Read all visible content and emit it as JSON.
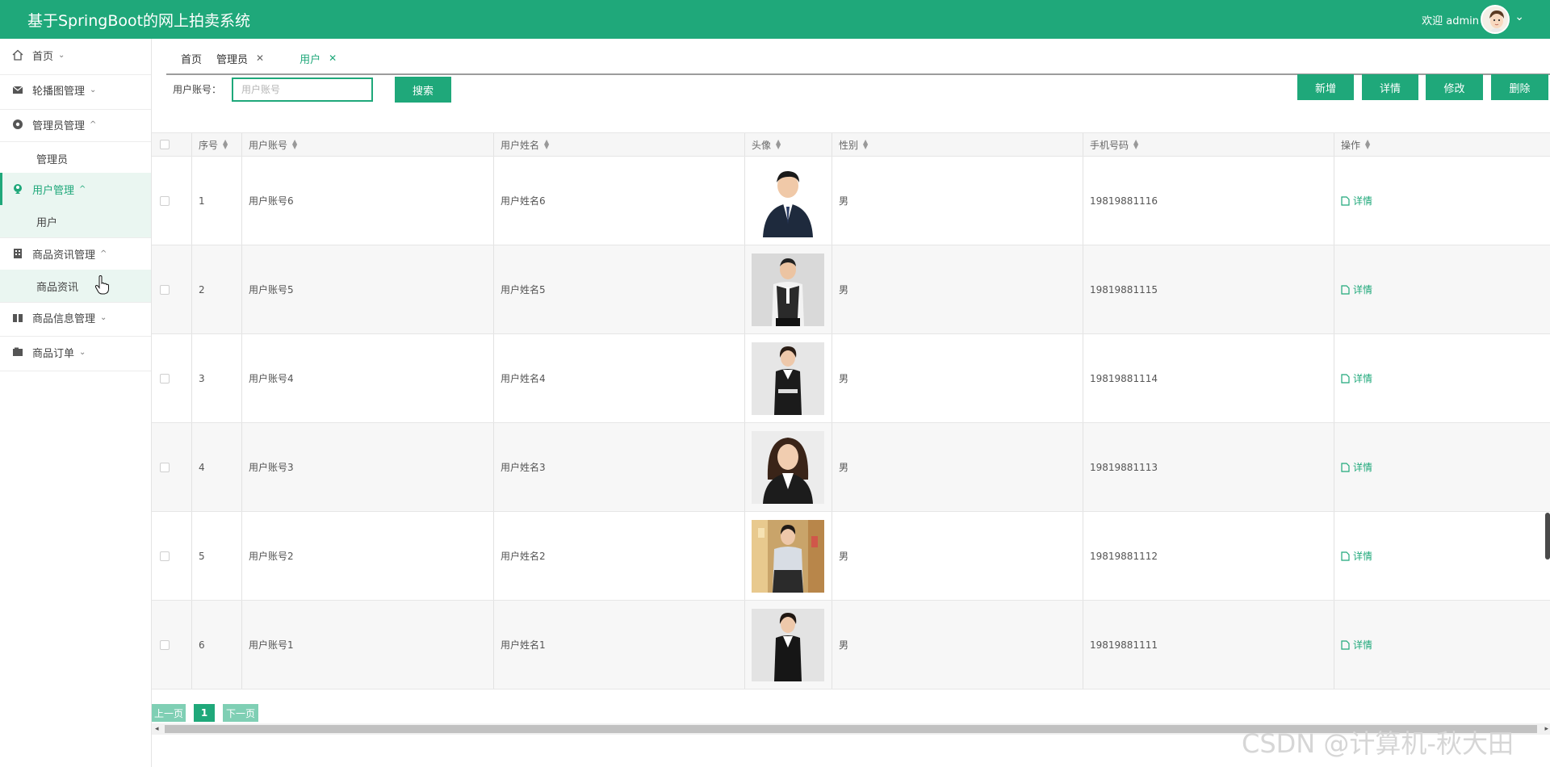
{
  "app": {
    "title": "基于SpringBoot的网上拍卖系统"
  },
  "header": {
    "welcome": "欢迎 admin",
    "avatar_icon": "avatar-icon",
    "caret": "⌄"
  },
  "sidebar": {
    "items": [
      {
        "label": "首页",
        "icon": "home-icon",
        "chevron": "⌄"
      },
      {
        "label": "轮播图管理",
        "icon": "mail-icon",
        "chevron": "⌄"
      },
      {
        "label": "管理员管理",
        "icon": "settings-icon",
        "chevron": "^",
        "children": [
          "管理员"
        ]
      },
      {
        "label": "用户管理",
        "icon": "user-badge-icon",
        "chevron": "^",
        "children": [
          "用户"
        ]
      },
      {
        "label": "商品资讯管理",
        "icon": "building-icon",
        "chevron": "^",
        "children": [
          "商品资讯"
        ]
      },
      {
        "label": "商品信息管理",
        "icon": "gift-icon",
        "chevron": "⌄"
      },
      {
        "label": "商品订单",
        "icon": "folder-icon",
        "chevron": "⌄"
      }
    ],
    "active": "用户管理"
  },
  "tabs": [
    {
      "label": "首页",
      "closable": false
    },
    {
      "label": "管理员",
      "closable": true
    },
    {
      "label": "用户",
      "closable": true,
      "active": true
    }
  ],
  "search": {
    "label": "用户账号：",
    "placeholder": "用户账号",
    "value": "",
    "button": "搜索"
  },
  "toolbar": {
    "add": "新增",
    "detail": "详情",
    "edit": "修改",
    "delete": "删除"
  },
  "table": {
    "columns": [
      "序号",
      "用户账号",
      "用户姓名",
      "头像",
      "性别",
      "手机号码",
      "操作"
    ],
    "rows": [
      {
        "index": "1",
        "account": "用户账号6",
        "name": "用户姓名6",
        "gender": "男",
        "phone": "19819881116",
        "action": "详情"
      },
      {
        "index": "2",
        "account": "用户账号5",
        "name": "用户姓名5",
        "gender": "男",
        "phone": "19819881115",
        "action": "详情"
      },
      {
        "index": "3",
        "account": "用户账号4",
        "name": "用户姓名4",
        "gender": "男",
        "phone": "19819881114",
        "action": "详情"
      },
      {
        "index": "4",
        "account": "用户账号3",
        "name": "用户姓名3",
        "gender": "男",
        "phone": "19819881113",
        "action": "详情"
      },
      {
        "index": "5",
        "account": "用户账号2",
        "name": "用户姓名2",
        "gender": "男",
        "phone": "19819881112",
        "action": "详情"
      },
      {
        "index": "6",
        "account": "用户账号1",
        "name": "用户姓名1",
        "gender": "男",
        "phone": "19819881111",
        "action": "详情"
      }
    ]
  },
  "pager": {
    "prev": "上一页",
    "current": "1",
    "next": "下一页"
  },
  "watermark": "CSDN @计算机-秋大田",
  "colors": {
    "primary": "#1fa87a",
    "pager_disabled": "#7fcfb4",
    "active_bg": "#eaf6f1"
  }
}
